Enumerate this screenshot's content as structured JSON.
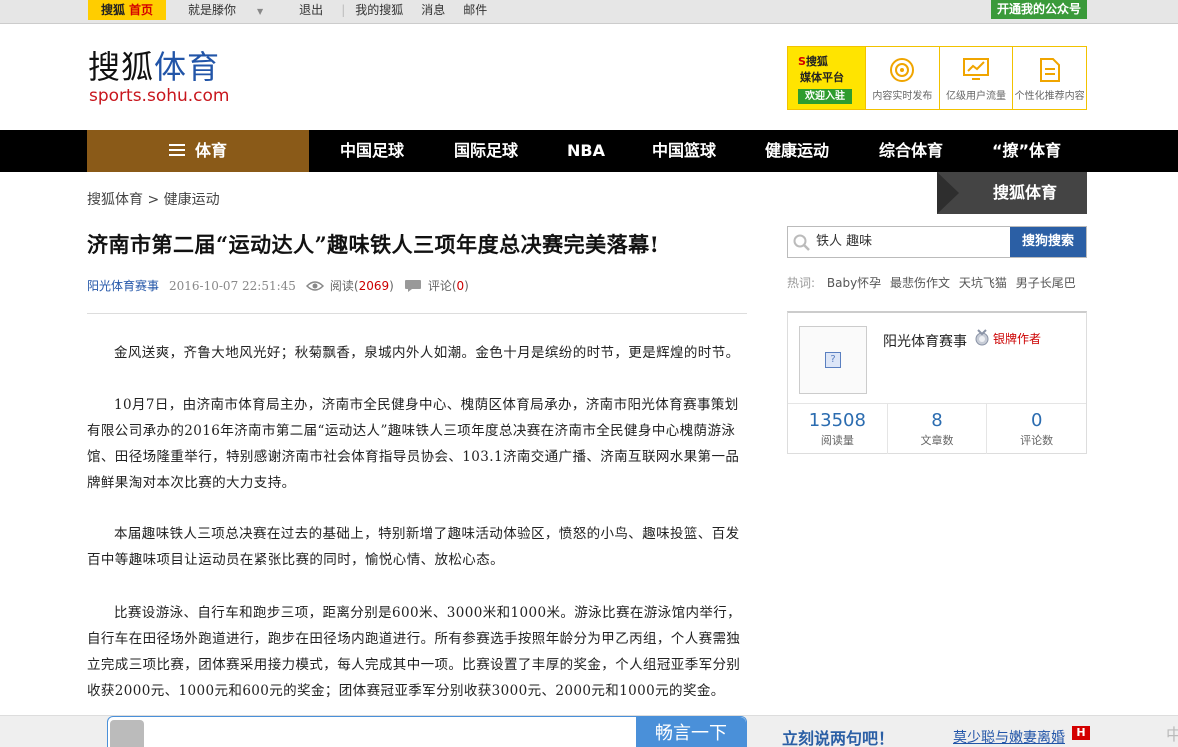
{
  "topbar": {
    "brand_prefix": "搜狐",
    "brand_home": "首页",
    "links": [
      "就是滕你",
      "退出",
      "我的搜狐",
      "消息",
      "邮件"
    ],
    "follow_label": "开通我的公众号"
  },
  "header": {
    "logo_cn_a": "搜狐",
    "logo_cn_b": "体育",
    "logo_en": "sports.sohu.com",
    "media": {
      "line1": "搜狐",
      "line2": "媒体平台",
      "button": "欢迎入驻",
      "items": [
        "内容实时发布",
        "亿级用户流量",
        "个性化推荐内容"
      ]
    }
  },
  "nav": {
    "home": "体育",
    "items": [
      "中国足球",
      "国际足球",
      "NBA",
      "中国篮球",
      "健康运动",
      "综合体育",
      "“撩”体育"
    ]
  },
  "breadcrumb": "搜狐体育 > 健康运动",
  "article": {
    "title": "济南市第二届“运动达人”趣味铁人三项年度总决赛完美落幕!",
    "author": "阳光体育赛事",
    "date": "2016-10-07 22:51:45",
    "read_label": "阅读(",
    "read_count": "2069",
    "comment_label": "评论(",
    "comment_count": "0",
    "close": ")",
    "paragraphs": [
      "金风送爽，齐鲁大地风光好；秋菊飘香，泉城内外人如潮。金色十月是缤纷的时节，更是辉煌的时节。",
      "10月7日，由济南市体育局主办，济南市全民健身中心、槐荫区体育局承办，济南市阳光体育赛事策划有限公司承办的2016年济南市第二届“运动达人”趣味铁人三项年度总决赛在济南市全民健身中心槐荫游泳馆、田径场隆重举行，特别感谢济南市社会体育指导员协会、103.1济南交通广播、济南互联网水果第一品牌鲜果淘对本次比赛的大力支持。",
      "本届趣味铁人三项总决赛在过去的基础上，特别新增了趣味活动体验区，愤怒的小鸟、趣味投篮、百发百中等趣味项目让运动员在紧张比赛的同时，愉悦心情、放松心态。",
      "比赛设游泳、自行车和跑步三项，距离分别是600米、3000米和1000米。游泳比赛在游泳馆内举行，自行车在田径场外跑道进行，跑步在田径场内跑道进行。所有参赛选手按照年龄分为甲乙丙组，个人赛需独立完成三项比赛，团体赛采用接力模式，每人完成其中一项。比赛设置了丰厚的奖金，个人组冠亚季军分别收获2000元、1000元和600元的奖金；团体赛冠亚季军分别收获3000元、2000元和1000元的奖金。"
    ]
  },
  "sidebar": {
    "tag": "搜狐体育",
    "search": {
      "value": "铁人 趣味",
      "button": "搜狗搜索"
    },
    "hot_label": "热词:",
    "hot_words": [
      "Baby怀孕",
      "最悲伤作文",
      "天坑飞猫",
      "男子长尾巴"
    ],
    "author_card": {
      "name": "阳光体育赛事",
      "badge": "银牌作者",
      "avatar_glyph": "?",
      "stats": [
        {
          "value": "13508",
          "label": "阅读量"
        },
        {
          "value": "8",
          "label": "文章数"
        },
        {
          "value": "0",
          "label": "评论数"
        }
      ]
    }
  },
  "bottombar": {
    "comment_button": "畅言一下",
    "talk_text": "立刻说两句吧！",
    "news_text": "莫少聪与嫩妻离婚",
    "news_badge": "H",
    "edge_glyph": "中"
  }
}
